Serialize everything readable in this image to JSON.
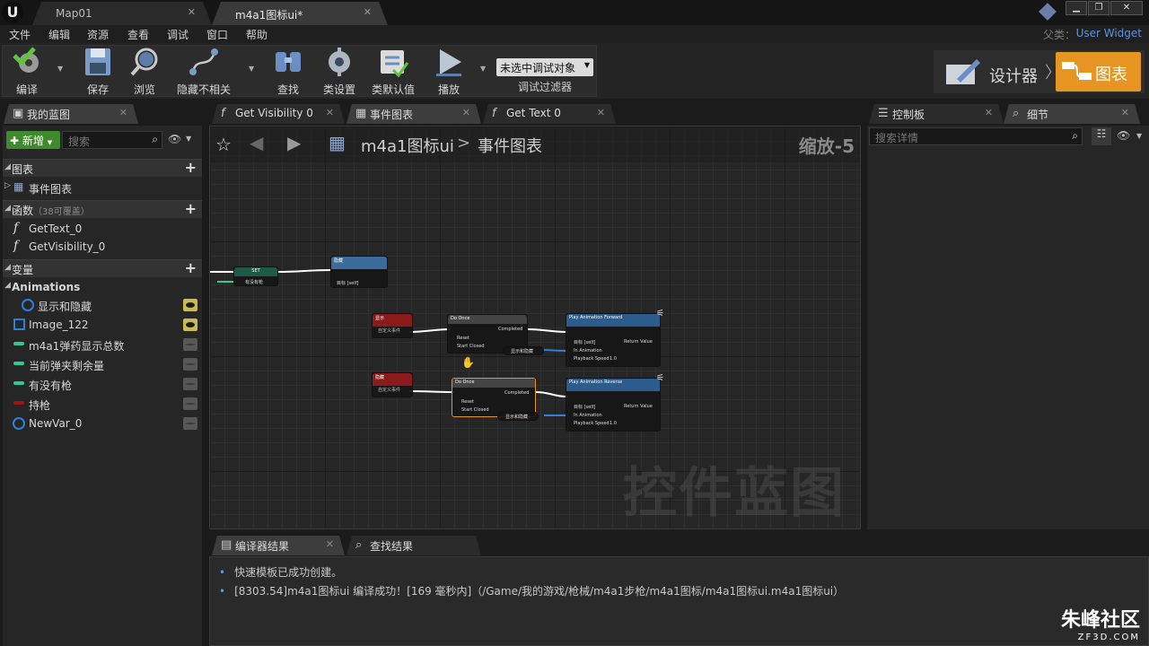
{
  "titlebar": {
    "logo": "U",
    "tabs": [
      {
        "label": "Map01"
      },
      {
        "label": "m4a1图标ui*"
      }
    ]
  },
  "menu": {
    "items": [
      "文件",
      "编辑",
      "资源",
      "查看",
      "调试",
      "窗口",
      "帮助"
    ],
    "parent_label": "父类：",
    "parent_value": "User Widget"
  },
  "toolbar": {
    "compile": "编译",
    "save": "保存",
    "browse": "浏览",
    "hide_unrelated": "隐藏不相关",
    "find": "查找",
    "class_settings": "类设置",
    "class_defaults": "类默认值",
    "play": "播放",
    "debug_select": "未选中调试对象",
    "debug_filter": "调试过滤器",
    "mode_designer": "设计器",
    "mode_graph": "图表"
  },
  "left_panel": {
    "tab": "我的蓝图",
    "new_button": "新增",
    "search_placeholder": "搜索",
    "sections": {
      "graphs": "图表",
      "event_graph": "事件图表",
      "functions": "函数",
      "functions_note": "（38可覆盖）",
      "variables": "变量",
      "animations": "Animations"
    },
    "functions": [
      "GetText_0",
      "GetVisibility_0"
    ],
    "animations": [
      {
        "label": "显示和隐藏",
        "eye": true
      }
    ],
    "variables": [
      {
        "label": "Image_122",
        "eye": true,
        "color": "#2e7fd9"
      },
      {
        "label": "m4a1弹药显示总数",
        "eye": false,
        "color": "#2fcb8f"
      },
      {
        "label": "当前弹夹剩余量",
        "eye": false,
        "color": "#2fcb8f"
      },
      {
        "label": "有没有枪",
        "eye": false,
        "color": "#2fcb8f"
      },
      {
        "label": "持枪",
        "eye": false,
        "color": "#a01414"
      },
      {
        "label": "NewVar_0",
        "eye": false,
        "color": "#2e7fd9"
      }
    ]
  },
  "graph_tabs": [
    {
      "label": "Get Visibility 0"
    },
    {
      "label": "事件图表"
    },
    {
      "label": "Get Text 0"
    }
  ],
  "graph": {
    "breadcrumb_root": "m4a1图标ui",
    "breadcrumb_separator": ">",
    "breadcrumb_current": "事件图表",
    "zoom": "缩放-5",
    "watermark": "控件蓝图",
    "nodes": {
      "set": "SET",
      "set_pin": "有没有枪",
      "hide_title": "隐藏",
      "hide_target": "目标 [self]",
      "show_event": "显示",
      "hide_event": "隐藏",
      "custom_event": "自定义事件",
      "do_once": "Do Once",
      "completed": "Completed",
      "reset": "Reset",
      "start_closed": "Start Closed",
      "play_forward": "Play Animation Forward",
      "play_reverse": "Play Animation Reverse",
      "target_self": "目标 [self]",
      "return_value": "Return Value",
      "in_animation": "In Animation",
      "playback_speed": "Playback Speed",
      "playback_value": "1.0",
      "anim_ref": "显示和隐藏"
    }
  },
  "right_panel": {
    "tab_palette": "控制板",
    "tab_details": "细节",
    "search_placeholder": "搜索详情"
  },
  "bottom_panel": {
    "tab_compiler": "编译器结果",
    "tab_find": "查找结果",
    "lines": [
      "快速模板已成功创建。",
      "[8303.54]m4a1图标ui 编译成功！[169 毫秒内]（/Game/我的游戏/枪械/m4a1步枪/m4a1图标/m4a1图标ui.m4a1图标ui）"
    ]
  },
  "brand": {
    "name": "朱峰社区",
    "url": "ZF3D.COM"
  }
}
